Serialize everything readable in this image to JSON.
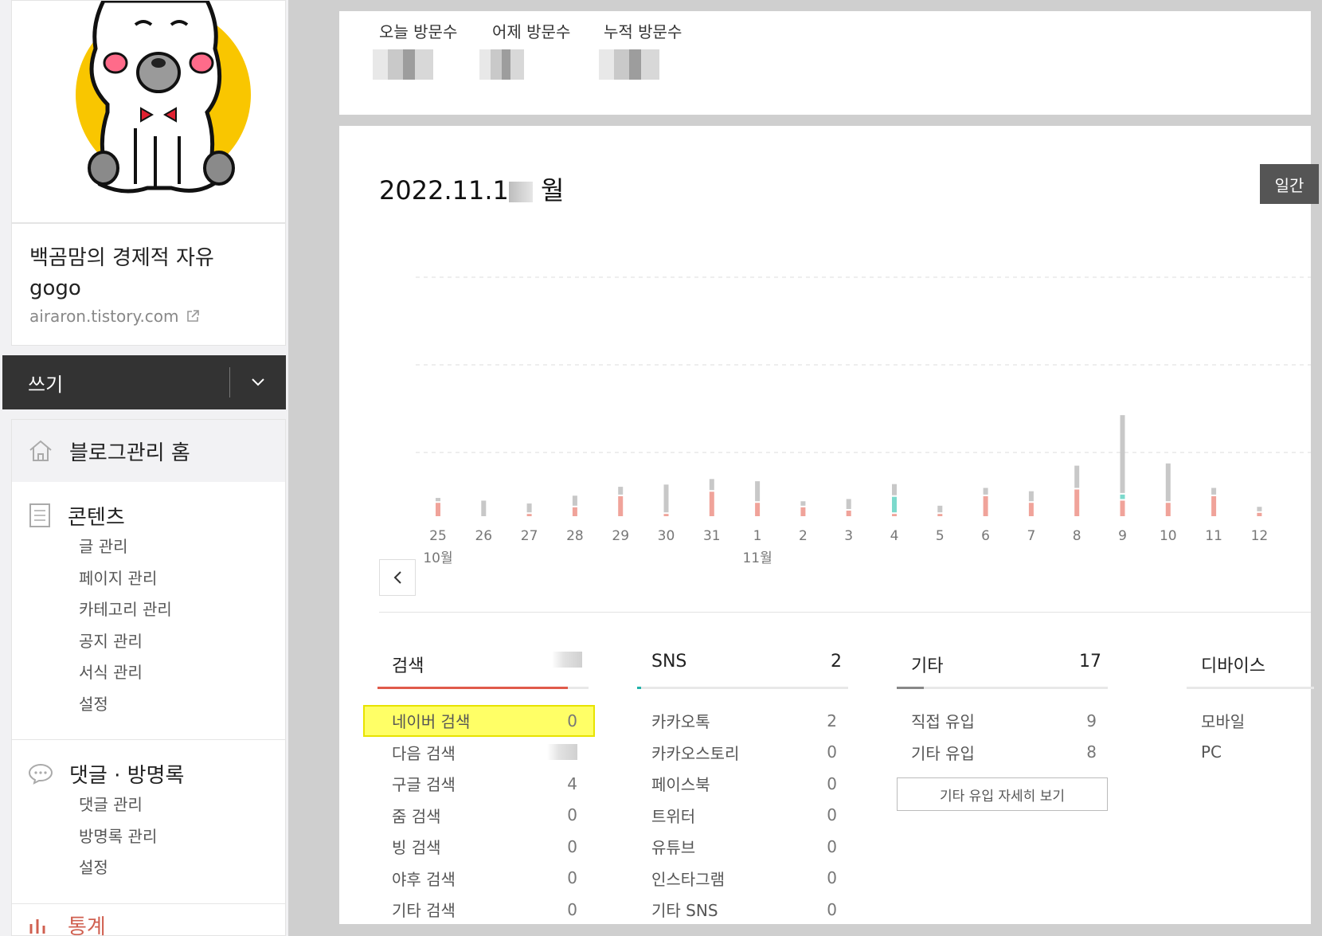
{
  "sidebar": {
    "blog_title": "백곰맘의 경제적 자유 gogo",
    "blog_url": "airaron.tistory.com",
    "write_label": "쓰기",
    "home_label": "블로그관리 홈",
    "contents": {
      "title": "콘텐츠",
      "items": [
        "글 관리",
        "페이지 관리",
        "카테고리 관리",
        "공지 관리",
        "서식 관리",
        "설정"
      ]
    },
    "comments": {
      "title": "댓글 · 방명록",
      "items": [
        "댓글 관리",
        "방명록 관리",
        "설정"
      ]
    },
    "next_section_partial": "통계"
  },
  "stats": {
    "today_label": "오늘 방문수",
    "yesterday_label": "어제 방문수",
    "total_label": "누적 방문수"
  },
  "chart_header": {
    "date_prefix": "2022.11.1",
    "date_suffix": "월",
    "period_button": "일간"
  },
  "chart_data": {
    "type": "bar",
    "categories": [
      "25",
      "26",
      "27",
      "28",
      "29",
      "30",
      "31",
      "1",
      "2",
      "3",
      "4",
      "5",
      "6",
      "7",
      "8",
      "9",
      "10",
      "11",
      "12"
    ],
    "month_labels": [
      {
        "at": "25",
        "label": "10월"
      },
      {
        "at": "1",
        "label": "11월"
      }
    ],
    "series": [
      {
        "name": "검색",
        "color": "#f0a39a",
        "values": [
          12,
          0,
          2,
          8,
          18,
          2,
          22,
          12,
          8,
          5,
          2,
          2,
          18,
          12,
          24,
          14,
          12,
          18,
          3
        ]
      },
      {
        "name": "SNS",
        "color": "#7cd9cc",
        "values": [
          0,
          0,
          0,
          0,
          0,
          0,
          0,
          0,
          0,
          0,
          14,
          0,
          0,
          0,
          0,
          4,
          0,
          0,
          0
        ]
      },
      {
        "name": "기타",
        "color": "#c8c8c8",
        "values": [
          3,
          14,
          8,
          9,
          7,
          25,
          10,
          18,
          4,
          9,
          10,
          6,
          6,
          9,
          20,
          70,
          34,
          6,
          4
        ]
      }
    ],
    "ylim": [
      0,
      130
    ],
    "gridlines": 3
  },
  "sources": {
    "search": {
      "title": "검색",
      "accent": "#e05a4a",
      "fill_fraction": 0.9,
      "rows": [
        {
          "label": "네이버 검색",
          "value": "0",
          "highlight": true
        },
        {
          "label": "다음 검색",
          "value": ""
        },
        {
          "label": "구글 검색",
          "value": "4"
        },
        {
          "label": "줌 검색",
          "value": "0"
        },
        {
          "label": "빙 검색",
          "value": "0"
        },
        {
          "label": "야후 검색",
          "value": "0"
        },
        {
          "label": "기타 검색",
          "value": "0"
        }
      ]
    },
    "sns": {
      "title": "SNS",
      "total": "2",
      "accent": "#20b2aa",
      "fill_fraction": 0.02,
      "rows": [
        {
          "label": "카카오톡",
          "value": "2"
        },
        {
          "label": "카카오스토리",
          "value": "0"
        },
        {
          "label": "페이스북",
          "value": "0"
        },
        {
          "label": "트위터",
          "value": "0"
        },
        {
          "label": "유튜브",
          "value": "0"
        },
        {
          "label": "인스타그램",
          "value": "0"
        },
        {
          "label": "기타 SNS",
          "value": "0"
        }
      ]
    },
    "etc": {
      "title": "기타",
      "total": "17",
      "accent": "#888888",
      "fill_fraction": 0.13,
      "rows": [
        {
          "label": "직접 유입",
          "value": "9"
        },
        {
          "label": "기타 유입",
          "value": "8"
        }
      ],
      "detail_button": "기타 유입 자세히 보기"
    },
    "device": {
      "title": "디바이스",
      "rows": [
        {
          "label": "모바일"
        },
        {
          "label": "PC"
        }
      ]
    }
  }
}
